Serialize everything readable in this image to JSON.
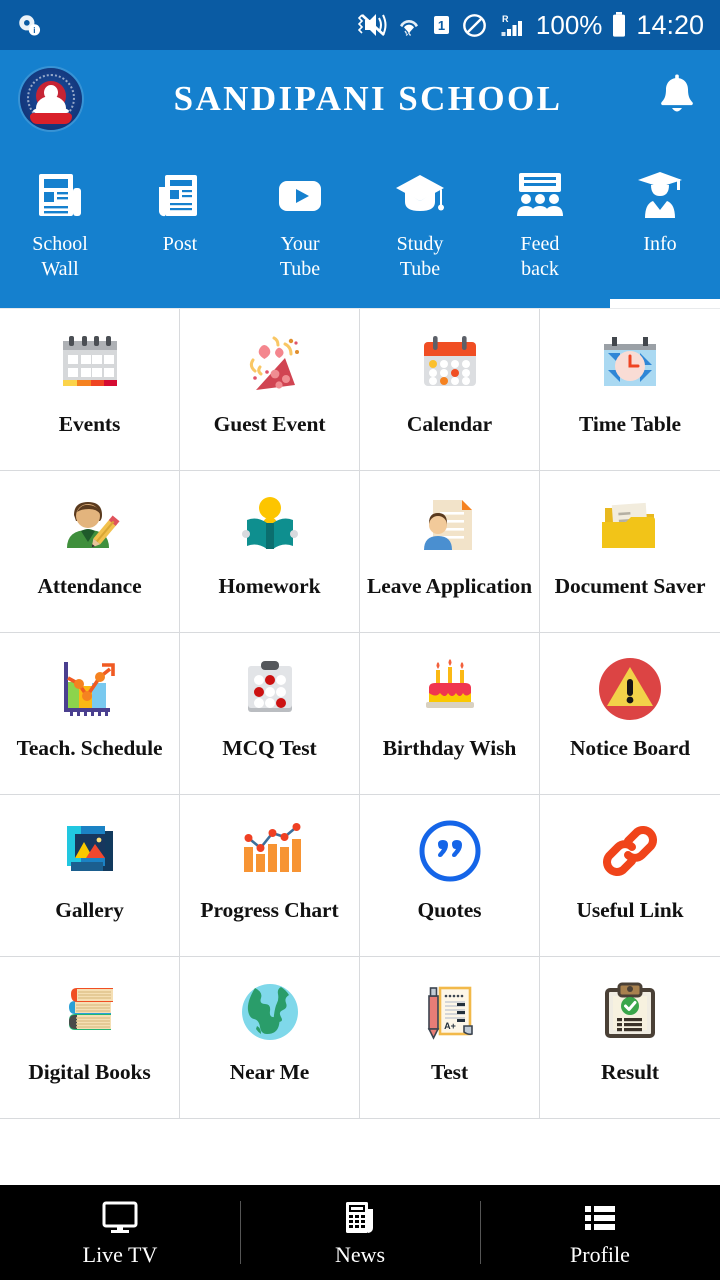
{
  "status_bar": {
    "icons": [
      "mute-vibrate-icon",
      "wifi-icon",
      "sim-1-icon",
      "do-not-disturb-icon",
      "signal-roaming-icon"
    ],
    "sim_label": "1",
    "roaming_label": "R",
    "battery_percent": "100%",
    "time": "14:20"
  },
  "header": {
    "logo_name": "sandipani-school-logo",
    "title": "SANDIPANI SCHOOL",
    "notification_icon": "bell-icon"
  },
  "tabs": {
    "selected_index": 5,
    "items": [
      {
        "label": "School\nWall",
        "icon": "newspaper-icon"
      },
      {
        "label": "Post",
        "icon": "post-article-icon"
      },
      {
        "label": "Your\nTube",
        "icon": "play-button-icon"
      },
      {
        "label": "Study\nTube",
        "icon": "graduation-cap-icon"
      },
      {
        "label": "Feed\nback",
        "icon": "feedback-people-icon"
      },
      {
        "label": "Info",
        "icon": "graduate-person-icon"
      }
    ]
  },
  "grid": {
    "items": [
      {
        "label": "Events",
        "icon": "calendar-events-icon"
      },
      {
        "label": "Guest Event",
        "icon": "party-popper-icon"
      },
      {
        "label": "Calendar",
        "icon": "calendar-dates-icon"
      },
      {
        "label": "Time Table",
        "icon": "calendar-clock-icon"
      },
      {
        "label": "Attendance",
        "icon": "person-pencil-icon"
      },
      {
        "label": "Homework",
        "icon": "open-book-reader-icon"
      },
      {
        "label": "Leave Application",
        "icon": "person-document-icon"
      },
      {
        "label": "Document Saver",
        "icon": "folder-documents-icon"
      },
      {
        "label": "Teach. Schedule",
        "icon": "growth-chart-arrow-icon"
      },
      {
        "label": "MCQ Test",
        "icon": "answer-sheet-icon"
      },
      {
        "label": "Birthday Wish",
        "icon": "birthday-cake-icon"
      },
      {
        "label": "Notice Board",
        "icon": "warning-alert-icon"
      },
      {
        "label": "Gallery",
        "icon": "photo-gallery-icon"
      },
      {
        "label": "Progress Chart",
        "icon": "bar-line-chart-icon"
      },
      {
        "label": "Quotes",
        "icon": "quotation-mark-icon"
      },
      {
        "label": "Useful Link",
        "icon": "chain-link-icon"
      },
      {
        "label": "Digital Books",
        "icon": "book-stack-icon"
      },
      {
        "label": "Near Me",
        "icon": "globe-earth-icon"
      },
      {
        "label": "Test",
        "icon": "pencil-exam-paper-icon"
      },
      {
        "label": "Result",
        "icon": "clipboard-check-icon"
      }
    ]
  },
  "bottom_nav": {
    "items": [
      {
        "label": "Live TV",
        "icon": "monitor-icon"
      },
      {
        "label": "News",
        "icon": "newspaper-icon"
      },
      {
        "label": "Profile",
        "icon": "list-icon"
      }
    ]
  },
  "colors": {
    "status_bar": "#0a5ba3",
    "app_bar": "#1580ce",
    "bottom_nav": "#000000",
    "grid_border": "#d8dadd"
  }
}
